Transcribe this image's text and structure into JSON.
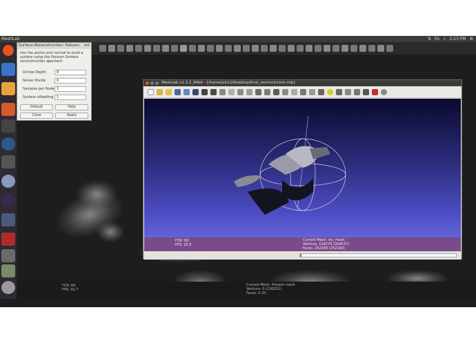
{
  "topbar": {
    "title": "MeshLab",
    "clock": "2:23 PM"
  },
  "dialog": {
    "title": "Surface Reconstruction: Poisson",
    "description": "Use the points and normal to build a surface using the Poisson Surface reconstruction approach.",
    "params": [
      {
        "label": "Octree Depth",
        "value": "8"
      },
      {
        "label": "Solver Divide",
        "value": "6"
      },
      {
        "label": "Samples per Node",
        "value": "1"
      },
      {
        "label": "Surface offsetting",
        "value": "1"
      }
    ],
    "buttons": {
      "default": "Default",
      "help": "Help",
      "close": "Close",
      "apply": "Apply"
    }
  },
  "window": {
    "title": "MeshLab v1.3.2_64bit - [/home/jcb12/Desktop/final_rev/rock/rock.mlp]",
    "info": {
      "fov": "FOV: 60",
      "fps": "FPS:   25.0",
      "mesh": "Current Mesh: mc_mesh",
      "vertices": "Vertices: 126276 (264527)",
      "faces": "Faces: 252160 (252160)"
    },
    "progress": 0.01
  },
  "outer_info": {
    "fov": "FOV: 60",
    "fps": "FPS:   41.7",
    "mesh": "Current Mesh: Poisson mesh",
    "vertices": "Vertices: 0 (136251)",
    "faces": "Faces: 0 (0)"
  },
  "colors": {
    "accent": "#e05c1c",
    "info_bar": "#7b4a8a",
    "launcher": "#2d2a33"
  },
  "icons": [
    "ubuntu-logo-icon",
    "files-icon",
    "firefox-icon",
    "terminal-icon",
    "settings-icon",
    "trash-icon"
  ]
}
